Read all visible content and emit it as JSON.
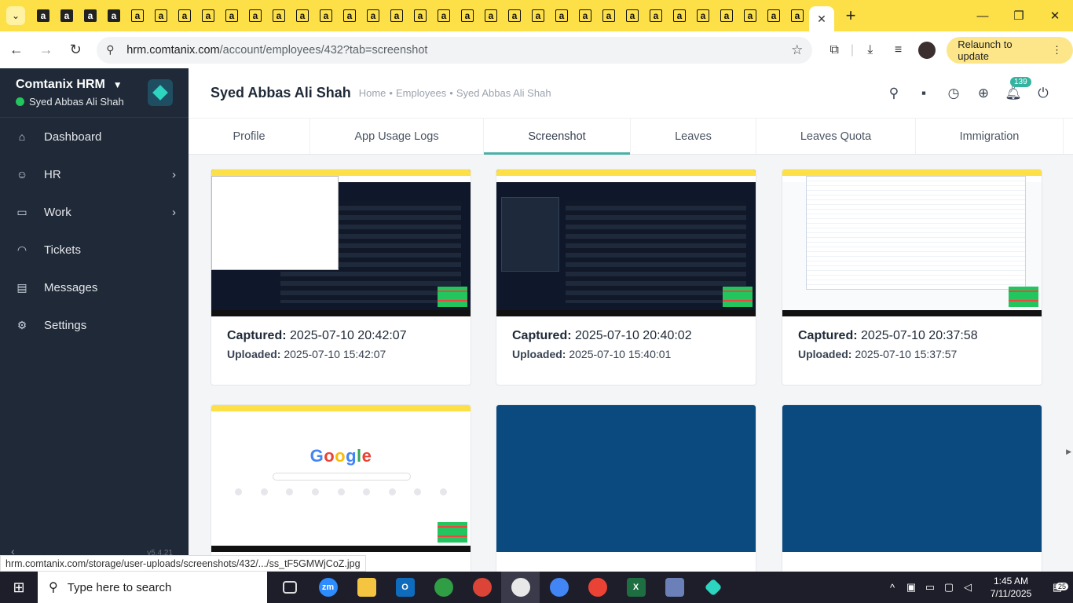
{
  "browser": {
    "tab_icons": [
      "a",
      "a",
      "a",
      "a",
      "a",
      "a",
      "a",
      "a",
      "a",
      "a",
      "a",
      "a",
      "a",
      "a",
      "a",
      "a",
      "a",
      "a",
      "a",
      "a",
      "a",
      "a",
      "a",
      "a",
      "a",
      "a",
      "a",
      "a",
      "a",
      "a",
      "a",
      "a",
      "a"
    ],
    "address": {
      "host": "hrm.comtanix.com",
      "path": "/account/employees/432?tab=screenshot"
    },
    "relaunch_label": "Relaunch to update",
    "status_url": "hrm.comtanix.com/storage/user-uploads/screenshots/432/.../ss_tF5GMWjCoZ.jpg"
  },
  "sidebar": {
    "app_name": "Comtanix HRM",
    "user_name": "Syed Abbas Ali Shah",
    "version": "v5.4.21",
    "items": [
      {
        "label": "Dashboard",
        "icon": "home-icon",
        "glyph": "⌂",
        "has_children": false
      },
      {
        "label": "HR",
        "icon": "people-icon",
        "glyph": "☺",
        "has_children": true
      },
      {
        "label": "Work",
        "icon": "briefcase-icon",
        "glyph": "▭",
        "has_children": true
      },
      {
        "label": "Tickets",
        "icon": "headset-icon",
        "glyph": "◠",
        "has_children": false
      },
      {
        "label": "Messages",
        "icon": "message-icon",
        "glyph": "▤",
        "has_children": false
      },
      {
        "label": "Settings",
        "icon": "gear-icon",
        "glyph": "⚙",
        "has_children": false
      }
    ]
  },
  "header": {
    "title": "Syed Abbas Ali Shah",
    "breadcrumb": [
      "Home",
      "Employees",
      "Syed Abbas Ali Shah"
    ],
    "notification_count": "139"
  },
  "tabs": [
    {
      "label": "Profile",
      "active": false
    },
    {
      "label": "App Usage Logs",
      "active": false
    },
    {
      "label": "Screenshot",
      "active": true
    },
    {
      "label": "Leaves",
      "active": false
    },
    {
      "label": "Leaves Quota",
      "active": false
    },
    {
      "label": "Immigration",
      "active": false
    }
  ],
  "screenshots": [
    {
      "captured_label": "Captured:",
      "captured": "2025-07-10 20:42:07",
      "uploaded_label": "Uploaded:",
      "uploaded": "2025-07-10 15:42:07",
      "thumb": "dark-explorer"
    },
    {
      "captured_label": "Captured:",
      "captured": "2025-07-10 20:40:02",
      "uploaded_label": "Uploaded:",
      "uploaded": "2025-07-10 15:40:01",
      "thumb": "dark-filter"
    },
    {
      "captured_label": "Captured:",
      "captured": "2025-07-10 20:37:58",
      "uploaded_label": "Uploaded:",
      "uploaded": "2025-07-10 15:37:57",
      "thumb": "light-explorer"
    },
    {
      "captured_label": "",
      "captured": "",
      "uploaded_label": "",
      "uploaded": "",
      "thumb": "google"
    },
    {
      "captured_label": "",
      "captured": "",
      "uploaded_label": "",
      "uploaded": "",
      "thumb": "navy"
    },
    {
      "captured_label": "",
      "captured": "",
      "uploaded_label": "",
      "uploaded": "",
      "thumb": "navy"
    }
  ],
  "taskbar": {
    "search_placeholder": "Type here to search",
    "time": "1:45 AM",
    "date": "7/11/2025",
    "notification_count": "25"
  },
  "colors": {
    "accent": "#4ab0a6",
    "sidebar_bg": "#1f2937",
    "tabstrip_bg": "#fde047",
    "thumb_navy": "#0b4a7f"
  }
}
